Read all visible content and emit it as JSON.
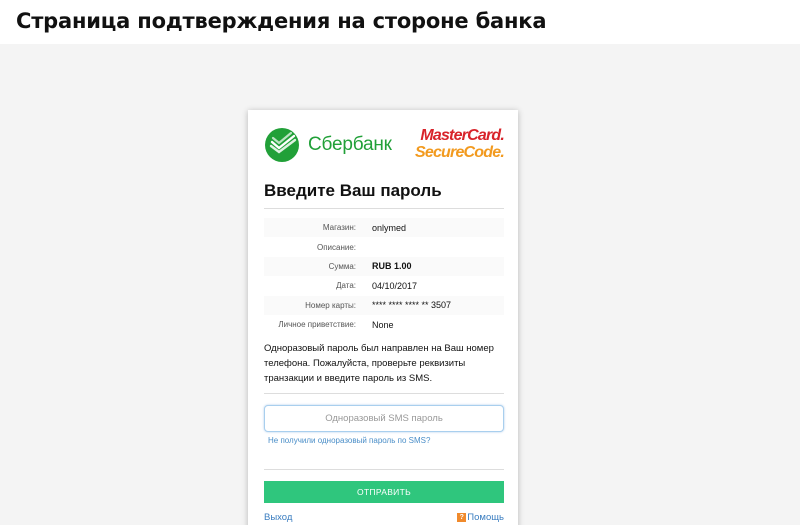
{
  "page": {
    "heading": "Страница подтверждения на стороне банка"
  },
  "bank": {
    "name": "Сбербанк",
    "color": "#21a038"
  },
  "card_brand": {
    "line1": "MasterCard.",
    "line2": "SecureCode."
  },
  "form": {
    "title": "Введите Ваш пароль",
    "details": [
      {
        "label": "Магазин:",
        "value": "onlymed",
        "bold": false
      },
      {
        "label": "Описание:",
        "value": "",
        "bold": false
      },
      {
        "label": "Сумма:",
        "value": "RUB 1.00",
        "bold": true
      },
      {
        "label": "Дата:",
        "value": "04/10/2017",
        "bold": false
      },
      {
        "label": "Номер карты:",
        "value": "**** **** **** ** 3507",
        "bold": false
      },
      {
        "label": "Личное приветствие:",
        "value": "None",
        "bold": false
      }
    ],
    "info_text": "Одноразовый пароль был направлен на Ваш номер телефона. Пожалуйста, проверьте реквизиты транзакции и введите пароль из SMS.",
    "otp_placeholder": "Одноразовый SMS пароль",
    "resend_link": "Не получили одноразовый пароль по SMS?",
    "submit_label": "ОТПРАВИТЬ",
    "exit_label": "Выход",
    "help_label": "Помощь",
    "help_icon_glyph": "?",
    "accent_color": "#2fc67d",
    "link_color": "#3a7dc0"
  }
}
